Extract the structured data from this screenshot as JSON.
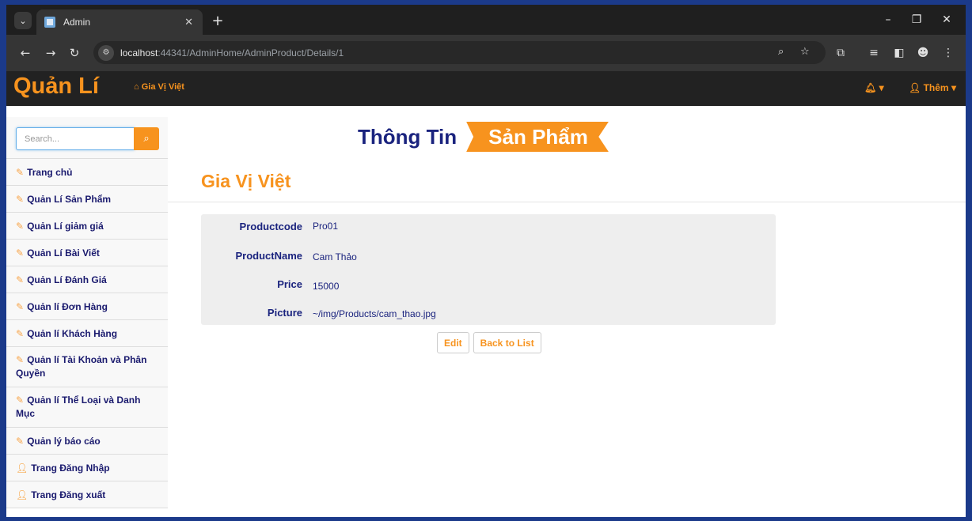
{
  "browser": {
    "tab_title": "Admin",
    "url_host": "localhost",
    "url_rest": ":44341/AdminHome/AdminProduct/Details/1"
  },
  "navbar": {
    "brand": "Quản Lí",
    "home_link": "Gia Vị Việt",
    "more_label": "Thêm"
  },
  "sidebar": {
    "search_placeholder": "Search...",
    "items": [
      {
        "label": "Trang chủ",
        "icon": "edit-icon"
      },
      {
        "label": "Quản Lí Sản Phẩm",
        "icon": "edit-icon"
      },
      {
        "label": "Quản Lí giảm giá",
        "icon": "edit-icon"
      },
      {
        "label": "Quản Lí Bài Viết",
        "icon": "edit-icon"
      },
      {
        "label": "Quản Lí Đánh Giá",
        "icon": "edit-icon"
      },
      {
        "label": "Quản lí Đơn Hàng",
        "icon": "edit-icon"
      },
      {
        "label": "Quản lí Khách Hàng",
        "icon": "edit-icon"
      },
      {
        "label": "Quản lí Tài Khoản và Phân Quyền",
        "icon": "edit-icon"
      },
      {
        "label": "Quản lí Thể Loại và Danh Mục",
        "icon": "edit-icon"
      },
      {
        "label": "Quản lý báo cáo",
        "icon": "edit-icon"
      },
      {
        "label": "Trang Đăng Nhập",
        "icon": "user-icon"
      },
      {
        "label": "Trang Đăng xuất",
        "icon": "user-icon"
      }
    ]
  },
  "main": {
    "heading_part1": "Thông Tin",
    "heading_part2": "Sản Phẩm",
    "product_title": "Gia Vị Việt",
    "fields": [
      {
        "label": "Productcode",
        "value": "Pro01"
      },
      {
        "label": "ProductName",
        "value": "Cam Thảo"
      },
      {
        "label": "Price",
        "value": "15000"
      },
      {
        "label": "Picture",
        "value": "~/img/Products/cam_thao.jpg"
      }
    ],
    "edit_label": "Edit",
    "back_label": "Back to List"
  },
  "colors": {
    "accent": "#f7931e",
    "navy": "#1a237e",
    "navbar_bg": "#222222"
  }
}
